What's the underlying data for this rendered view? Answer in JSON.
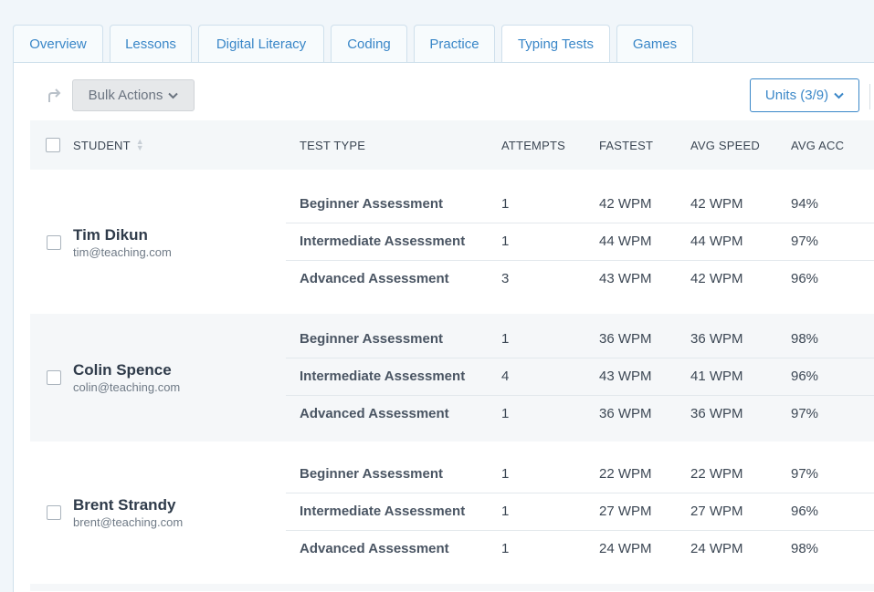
{
  "tabs": [
    {
      "label": "Overview"
    },
    {
      "label": "Lessons"
    },
    {
      "label": "Digital Literacy"
    },
    {
      "label": "Coding"
    },
    {
      "label": "Practice"
    },
    {
      "label": "Typing Tests",
      "active": true
    },
    {
      "label": "Games"
    }
  ],
  "toolbar": {
    "bulk_label": "Bulk Actions",
    "units_label": "Units (3/9)"
  },
  "table": {
    "headers": {
      "student": "STUDENT",
      "test_type": "TEST TYPE",
      "attempts": "ATTEMPTS",
      "fastest": "FASTEST",
      "avg_speed": "AVG SPEED",
      "avg_acc": "AVG ACC"
    },
    "students": [
      {
        "name": "Tim Dikun",
        "email": "tim@teaching.com",
        "tests": [
          {
            "type": "Beginner Assessment",
            "attempts": "1",
            "fastest": "42 WPM",
            "avg_speed": "42 WPM",
            "avg_acc": "94%"
          },
          {
            "type": "Intermediate Assessment",
            "attempts": "1",
            "fastest": "44 WPM",
            "avg_speed": "44 WPM",
            "avg_acc": "97%"
          },
          {
            "type": "Advanced Assessment",
            "attempts": "3",
            "fastest": "43 WPM",
            "avg_speed": "42 WPM",
            "avg_acc": "96%"
          }
        ]
      },
      {
        "name": "Colin Spence",
        "email": "colin@teaching.com",
        "tests": [
          {
            "type": "Beginner Assessment",
            "attempts": "1",
            "fastest": "36 WPM",
            "avg_speed": "36 WPM",
            "avg_acc": "98%"
          },
          {
            "type": "Intermediate Assessment",
            "attempts": "4",
            "fastest": "43 WPM",
            "avg_speed": "41 WPM",
            "avg_acc": "96%"
          },
          {
            "type": "Advanced Assessment",
            "attempts": "1",
            "fastest": "36 WPM",
            "avg_speed": "36 WPM",
            "avg_acc": "97%"
          }
        ]
      },
      {
        "name": "Brent Strandy",
        "email": "brent@teaching.com",
        "tests": [
          {
            "type": "Beginner Assessment",
            "attempts": "1",
            "fastest": "22 WPM",
            "avg_speed": "22 WPM",
            "avg_acc": "97%"
          },
          {
            "type": "Intermediate Assessment",
            "attempts": "1",
            "fastest": "27 WPM",
            "avg_speed": "27 WPM",
            "avg_acc": "96%"
          },
          {
            "type": "Advanced Assessment",
            "attempts": "1",
            "fastest": "24 WPM",
            "avg_speed": "24 WPM",
            "avg_acc": "98%"
          }
        ]
      }
    ]
  },
  "icons": {
    "undo": "undo-arrow-icon",
    "chevron": "chevron-down-icon",
    "sort": "sort-icon"
  },
  "colors": {
    "accent": "#3a87c8",
    "page_bg": "#f1f6fa"
  }
}
